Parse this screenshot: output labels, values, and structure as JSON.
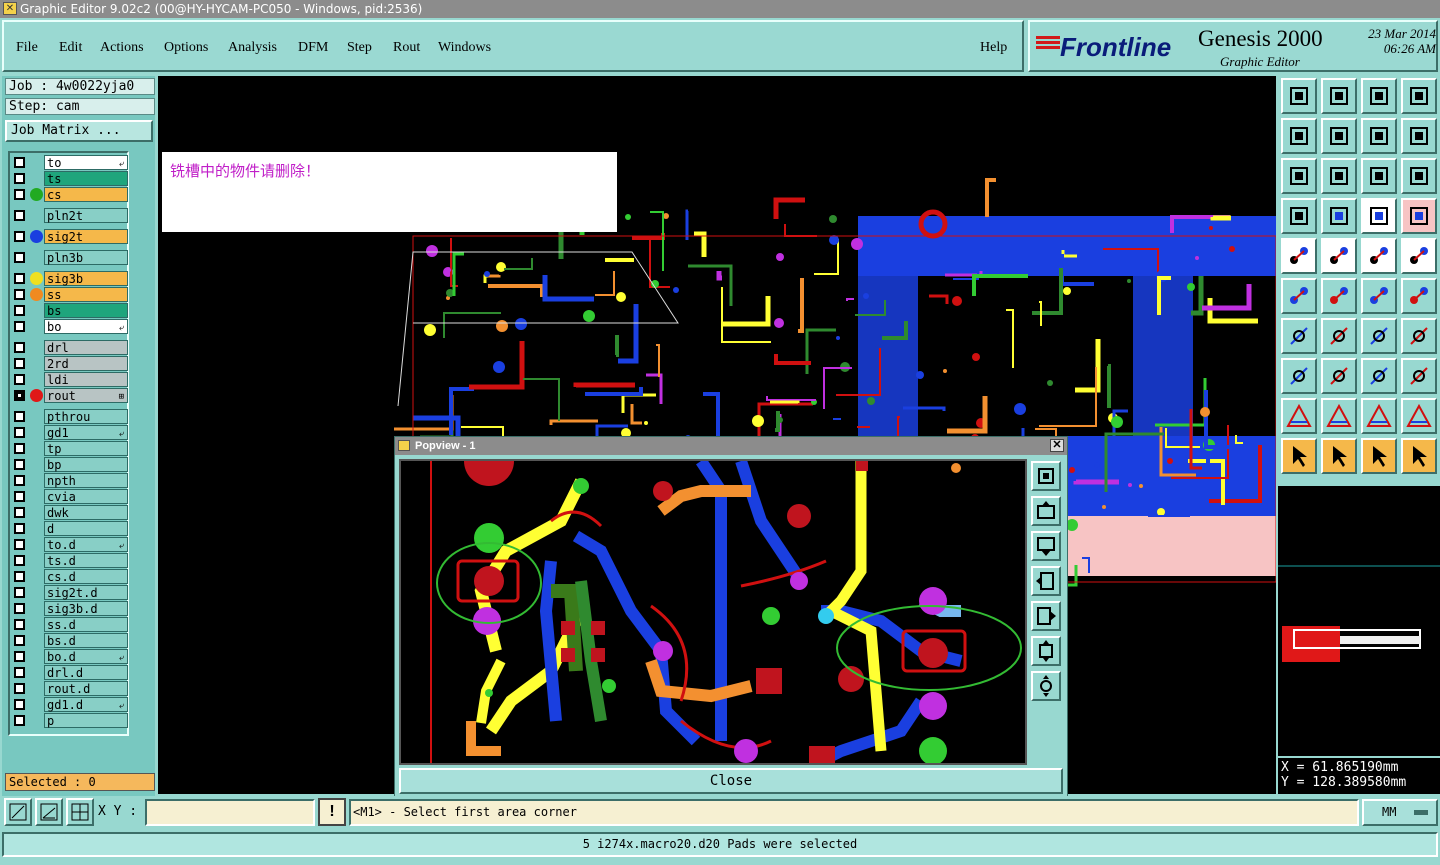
{
  "window": {
    "title": "Graphic Editor 9.02c2 (00@HY-HYCAM-PC050 - Windows, pid:2536)"
  },
  "menu": {
    "items": [
      "File",
      "Edit",
      "Actions",
      "Options",
      "Analysis",
      "DFM",
      "Step",
      "Rout",
      "Windows"
    ],
    "help": "Help"
  },
  "brand": {
    "logo": "Frontline",
    "product": "Genesis 2000",
    "date": "23 Mar 2014",
    "time": "06:26 AM",
    "subtitle": "Graphic Editor"
  },
  "job": {
    "job_label": "Job : 4w0022yja0",
    "step_label": "Step: cam",
    "matrix_button": "Job Matrix ..."
  },
  "layers": [
    {
      "name": "to",
      "bg": "#ffffff",
      "mark": "⤶",
      "dot": ""
    },
    {
      "name": "ts",
      "bg": "#1fa57c",
      "mark": "",
      "dot": ""
    },
    {
      "name": "cs",
      "bg": "#f5b84a",
      "mark": "",
      "dot": "#22aa22"
    },
    {
      "name": "pln2t",
      "bg": "#88cfc6",
      "mark": "",
      "dot": ""
    },
    {
      "name": "sig2t",
      "bg": "#f5b84a",
      "mark": "",
      "dot": "#1a3fe0"
    },
    {
      "name": "pln3b",
      "bg": "#88cfc6",
      "mark": "",
      "dot": ""
    },
    {
      "name": "sig3b",
      "bg": "#f5b84a",
      "mark": "",
      "dot": "#f0e020"
    },
    {
      "name": "ss",
      "bg": "#f5b84a",
      "mark": "",
      "dot": "#f08a20"
    },
    {
      "name": "bs",
      "bg": "#1fa57c",
      "mark": "",
      "dot": ""
    },
    {
      "name": "bo",
      "bg": "#ffffff",
      "mark": "⤶",
      "dot": ""
    },
    {
      "name": "drl",
      "bg": "#b8c4c4",
      "mark": "",
      "dot": ""
    },
    {
      "name": "2rd",
      "bg": "#b8c4c4",
      "mark": "",
      "dot": ""
    },
    {
      "name": "ldi",
      "bg": "#b8c4c4",
      "mark": "",
      "dot": ""
    },
    {
      "name": "rout",
      "bg": "#b8c4c4",
      "mark": "⊞",
      "dot": "#e01818"
    },
    {
      "name": "pthrou",
      "bg": "#88cfc6",
      "mark": "",
      "dot": ""
    },
    {
      "name": "gd1",
      "bg": "#88cfc6",
      "mark": "⤶",
      "dot": ""
    },
    {
      "name": "tp",
      "bg": "#88cfc6",
      "mark": "",
      "dot": ""
    },
    {
      "name": "bp",
      "bg": "#88cfc6",
      "mark": "",
      "dot": ""
    },
    {
      "name": "npth",
      "bg": "#88cfc6",
      "mark": "",
      "dot": ""
    },
    {
      "name": "cvia",
      "bg": "#88cfc6",
      "mark": "",
      "dot": ""
    },
    {
      "name": "dwk",
      "bg": "#88cfc6",
      "mark": "",
      "dot": ""
    },
    {
      "name": "d",
      "bg": "#88cfc6",
      "mark": "",
      "dot": ""
    },
    {
      "name": "to.d",
      "bg": "#88cfc6",
      "mark": "⤶",
      "dot": ""
    },
    {
      "name": "ts.d",
      "bg": "#88cfc6",
      "mark": "",
      "dot": ""
    },
    {
      "name": "cs.d",
      "bg": "#88cfc6",
      "mark": "",
      "dot": ""
    },
    {
      "name": "sig2t.d",
      "bg": "#88cfc6",
      "mark": "",
      "dot": ""
    },
    {
      "name": "sig3b.d",
      "bg": "#88cfc6",
      "mark": "",
      "dot": ""
    },
    {
      "name": "ss.d",
      "bg": "#88cfc6",
      "mark": "",
      "dot": ""
    },
    {
      "name": "bs.d",
      "bg": "#88cfc6",
      "mark": "",
      "dot": ""
    },
    {
      "name": "bo.d",
      "bg": "#88cfc6",
      "mark": "⤶",
      "dot": ""
    },
    {
      "name": "drl.d",
      "bg": "#88cfc6",
      "mark": "",
      "dot": ""
    },
    {
      "name": "rout.d",
      "bg": "#88cfc6",
      "mark": "",
      "dot": ""
    },
    {
      "name": "gd1.d",
      "bg": "#88cfc6",
      "mark": "⤶",
      "dot": ""
    },
    {
      "name": "p",
      "bg": "#88cfc6",
      "mark": "",
      "dot": ""
    }
  ],
  "selected": "Selected : 0",
  "message": "铣槽中的物件请删除！",
  "popview": {
    "title": "Popview - 1",
    "close": "Close"
  },
  "coords": {
    "x": "X  =  61.865190mm",
    "y": "Y  = 128.389580mm"
  },
  "bottom": {
    "xy_label": "X Y :",
    "xy_value": "",
    "prompt": "<M1> - Select first area corner",
    "units": "MM"
  },
  "status": "5 i274x.macro20.d20 Pads were selected",
  "tools": [
    "zoom-home-icon",
    "zoom-in-icon",
    "home-icon",
    "window-split-icon",
    "pan-left-icon",
    "pan-right-icon",
    "flip-icon",
    "snake-icon",
    "fit-icon",
    "center-icon",
    "ratio-icon",
    "help-icon",
    "measure-icon",
    "line-tool-icon",
    "layer-compare-icon",
    "layer-compare-active-icon",
    "pad-icon",
    "polygon-icon",
    "ruler-icon",
    "snap-icon",
    "connect-icon",
    "delete-icon",
    "move-icon",
    "copy-icon",
    "angle-icon",
    "line-icon",
    "arc-icon",
    "mirror-icon",
    "select-icon",
    "resize-icon",
    "array-icon",
    "transform-icon",
    "triangle-a-icon",
    "triangle-b-icon",
    "triangle-c-icon",
    "triangle-d-icon",
    "pointer-icon",
    "pointer-box-icon",
    "pointer-select-icon",
    "pointer-net-icon"
  ]
}
